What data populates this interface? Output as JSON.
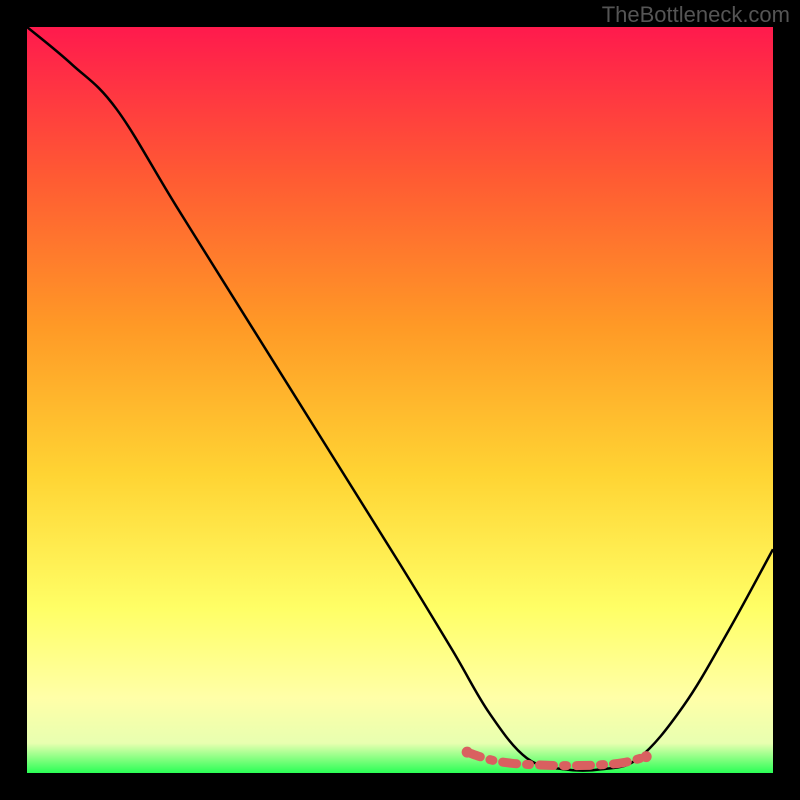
{
  "watermark": "TheBottleneck.com",
  "chart_data": {
    "type": "line",
    "title": "",
    "xlabel": "",
    "ylabel": "",
    "xlim": [
      0,
      100
    ],
    "ylim": [
      0,
      100
    ],
    "grid": false,
    "legend": false,
    "series": [
      {
        "name": "curve",
        "x": [
          0,
          6,
          12,
          20,
          30,
          40,
          50,
          57,
          62,
          67,
          72,
          77,
          82,
          88,
          94,
          100
        ],
        "y": [
          100,
          95,
          89,
          76,
          60,
          44,
          28,
          16.5,
          8,
          2,
          0.5,
          0.5,
          2,
          9,
          19,
          30
        ]
      },
      {
        "name": "highlighted-segment",
        "x": [
          59,
          62,
          65,
          68,
          71,
          74,
          77,
          80,
          83
        ],
        "y": [
          2.8,
          1.8,
          1.3,
          1.1,
          1.0,
          1.0,
          1.1,
          1.4,
          2.2
        ]
      }
    ],
    "gradient_stops": [
      {
        "offset": 0,
        "color": "#ff1a4d"
      },
      {
        "offset": 20,
        "color": "#ff5a33"
      },
      {
        "offset": 40,
        "color": "#ff9926"
      },
      {
        "offset": 60,
        "color": "#ffd433"
      },
      {
        "offset": 78,
        "color": "#ffff66"
      },
      {
        "offset": 90,
        "color": "#ffffa8"
      },
      {
        "offset": 96,
        "color": "#e8ffb0"
      },
      {
        "offset": 100,
        "color": "#2aff55"
      }
    ],
    "curve_color": "#000000",
    "highlight_color": "#d96060"
  }
}
